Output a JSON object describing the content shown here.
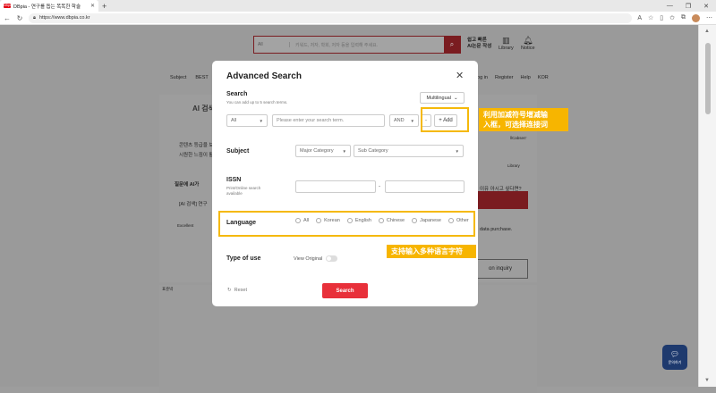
{
  "browser": {
    "tab_title": "DBpia - 연구를 돕는 똑똑한 학술",
    "tab_favicon": "DBpia",
    "url": "https://www.dbpia.co.kr",
    "new_tab": "+",
    "window_controls": [
      "—",
      "❐",
      "✕"
    ]
  },
  "background_page": {
    "search_select": "All",
    "search_placeholder": "키워드, 저자, 학회, 저자 등을 입력해 주세요.",
    "ai_promo": "쉽고 빠른\nAI논문 작성",
    "library": "Library",
    "notice": "Notice",
    "nav_left": [
      "Subject",
      "BEST"
    ],
    "nav_right": [
      "Log in",
      "Register",
      "Help",
      "KOR"
    ],
    "ai_section_title": "AI 검색",
    "texts": [
      "콘텐츠 등급을 보완",
      "시원한 느낌이 활",
      "질문에 AI가",
      "[AI 검색] 연구",
      "Excellent",
      "llCabsen'",
      "Library",
      "이유 아시고 싶다면?",
      "data purchase.",
      "on inquiry",
      "표준박"
    ],
    "chat_button": "문의하기"
  },
  "modal": {
    "title": "Advanced Search",
    "search_label": "Search",
    "search_hint": "You can add up to 5 search terms.",
    "language_mode": "Multilingual",
    "field_select": "All",
    "term_placeholder": "Please enter your search term.",
    "operator": "AND",
    "remove_label": "-",
    "add_label": "+ Add",
    "subject_label": "Subject",
    "major_category": "Major Category",
    "sub_category": "Sub Category",
    "issn_label": "ISSN",
    "issn_hint1": "Print/Online search",
    "issn_hint2": "available",
    "issn_dash": "-",
    "language_label": "Language",
    "languages": [
      "All",
      "Korean",
      "English",
      "Chinese",
      "Japanese",
      "Other"
    ],
    "type_label": "Type of use",
    "view_original": "View Original",
    "reset": "Reset",
    "search_button": "Search"
  },
  "annotations": {
    "callout_add": "利用加减符号增减输\n入框，可选择连接词",
    "callout_language": "支持输入多种语言字符"
  },
  "colors": {
    "accent_red": "#e8303a",
    "highlight": "#f5b90a",
    "callout_bg": "#f7b500"
  }
}
